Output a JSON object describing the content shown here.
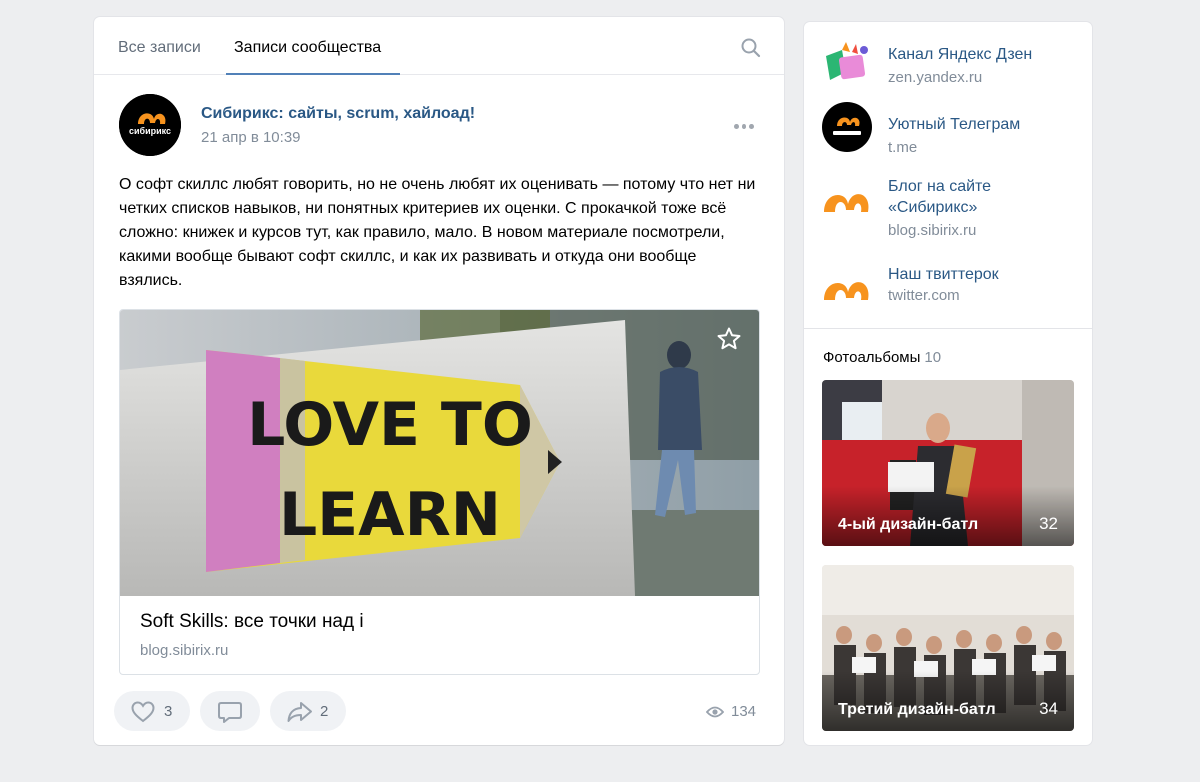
{
  "tabs": {
    "all": "Все записи",
    "community": "Записи сообщества"
  },
  "post": {
    "author": "Сибирикс: сайты, scrum, хайлоад!",
    "date": "21 апр в 10:39",
    "text": "О софт скиллс любят говорить, но не очень любят их оценивать — потому что нет ни четких списков навыков, ни понятных критериев их оценки. С прокачкой тоже всё сложно: книжек и курсов тут, как правило, мало. В новом материале посмотрели, какими вообще бывают софт скиллс, и как их развивать и откуда они вообще взялись.",
    "photo_text_line1": "LOVE TO",
    "photo_text_line2": "LEARN",
    "link_title": "Soft Skills: все точки над i",
    "link_domain": "blog.sibirix.ru",
    "likes": "3",
    "shares": "2",
    "views": "134",
    "avatar_logo_text": "сибирикс"
  },
  "sidebar": {
    "links": [
      {
        "name": "Канал Яндекс Дзен",
        "sub": "zen.yandex.ru",
        "icon": "zen-icon"
      },
      {
        "name": "Уютный Телеграм",
        "sub": "t.me",
        "icon": "sibirix-logo-icon"
      },
      {
        "name": "Блог на сайте «Сибирикс»",
        "sub": "blog.sibirix.ru",
        "icon": "sibirix-mark-icon"
      },
      {
        "name": "Наш твиттерок",
        "sub": "twitter.com",
        "icon": "sibirix-mark-icon"
      }
    ],
    "albums_title": "Фотоальбомы",
    "albums_count": "10",
    "albums": [
      {
        "title": "4-ый дизайн-батл",
        "count": "32"
      },
      {
        "title": "Третий дизайн-батл",
        "count": "34"
      }
    ]
  },
  "colors": {
    "accent": "#5181b8",
    "link": "#2a5885",
    "muted": "#818c99",
    "brand_orange": "#f7931e"
  }
}
